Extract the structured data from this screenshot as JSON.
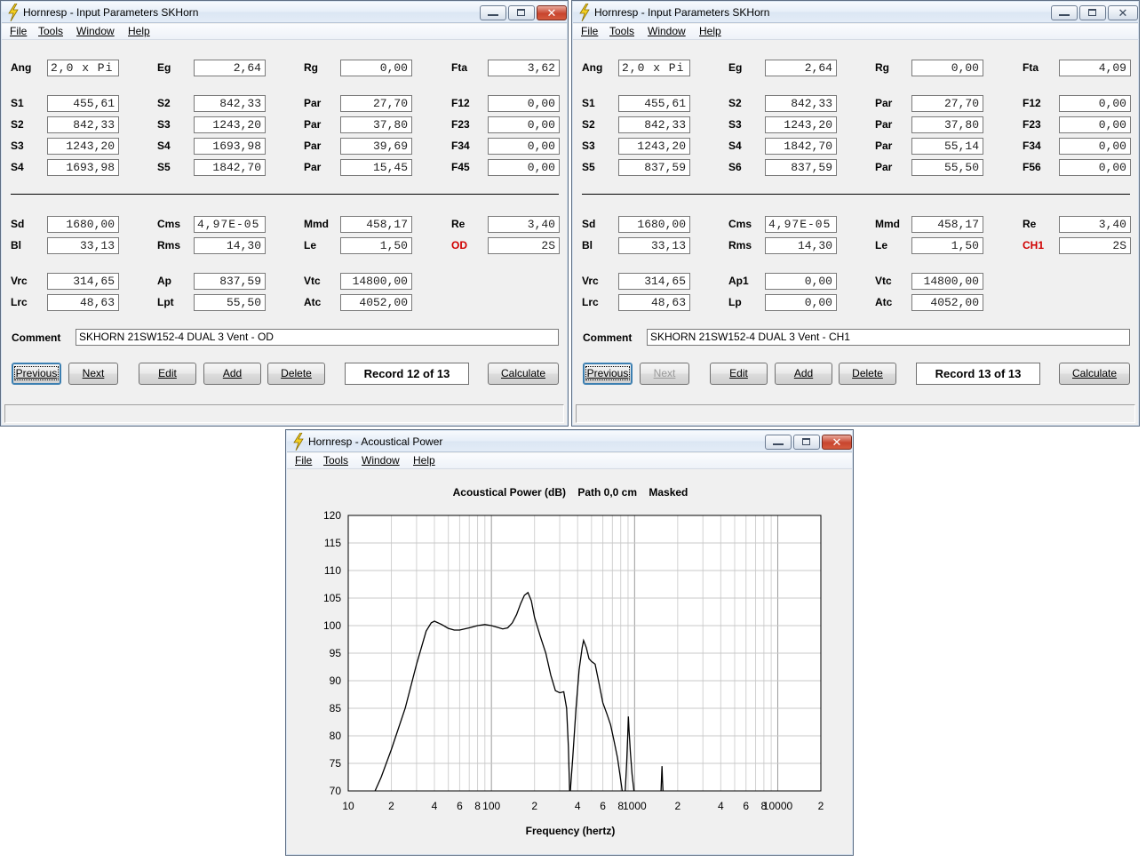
{
  "colors": {
    "accent_red": "#d00000",
    "window_bg": "#f0f0f0",
    "chart_line": "#000000"
  },
  "menu": {
    "file": "File",
    "tools": "Tools",
    "window": "Window",
    "help": "Help"
  },
  "left": {
    "title": "Hornresp - Input Parameters   SKHorn",
    "labels": {
      "ang": "Ang",
      "eg": "Eg",
      "rg": "Rg",
      "fta": "Fta",
      "r1a": "S1",
      "r1b": "S2",
      "r1c": "Par",
      "r1d": "F12",
      "r2a": "S2",
      "r2b": "S3",
      "r2c": "Par",
      "r2d": "F23",
      "r3a": "S3",
      "r3b": "S4",
      "r3c": "Par",
      "r3d": "F34",
      "r4a": "S4",
      "r4b": "S5",
      "r4c": "Par",
      "r4d": "F45",
      "sd": "Sd",
      "cms": "Cms",
      "mmd": "Mmd",
      "re": "Re",
      "bl": "Bl",
      "rms": "Rms",
      "le": "Le",
      "od": "OD",
      "vrc": "Vrc",
      "ap": "Ap",
      "vtc": "Vtc",
      "lrc": "Lrc",
      "lpt": "Lpt",
      "atc": "Atc",
      "comment": "Comment"
    },
    "values": {
      "ang": "2,0 x Pi",
      "eg": "2,64",
      "rg": "0,00",
      "fta": "3,62",
      "r1a": "455,61",
      "r1b": "842,33",
      "r1c": "27,70",
      "r1d": "0,00",
      "r2a": "842,33",
      "r2b": "1243,20",
      "r2c": "37,80",
      "r2d": "0,00",
      "r3a": "1243,20",
      "r3b": "1693,98",
      "r3c": "39,69",
      "r3d": "0,00",
      "r4a": "1693,98",
      "r4b": "1842,70",
      "r4c": "15,45",
      "r4d": "0,00",
      "sd": "1680,00",
      "cms": "4,97E-05",
      "mmd": "458,17",
      "re": "3,40",
      "bl": "33,13",
      "rms": "14,30",
      "le": "1,50",
      "od": "2S",
      "vrc": "314,65",
      "ap": "837,59",
      "vtc": "14800,00",
      "lrc": "48,63",
      "lpt": "55,50",
      "atc": "4052,00",
      "comment": "SKHORN 21SW152-4 DUAL 3 Vent - OD"
    },
    "buttons": {
      "previous": "Previous",
      "next": "Next",
      "edit": "Edit",
      "add": "Add",
      "delete": "Delete",
      "calculate": "Calculate"
    },
    "record": "Record 12 of 13"
  },
  "right": {
    "title": "Hornresp - Input Parameters   SKHorn",
    "labels": {
      "ang": "Ang",
      "eg": "Eg",
      "rg": "Rg",
      "fta": "Fta",
      "r1a": "S1",
      "r1b": "S2",
      "r1c": "Par",
      "r1d": "F12",
      "r2a": "S2",
      "r2b": "S3",
      "r2c": "Par",
      "r2d": "F23",
      "r3a": "S3",
      "r3b": "S4",
      "r3c": "Par",
      "r3d": "F34",
      "r4a": "S5",
      "r4b": "S6",
      "r4c": "Par",
      "r4d": "F56",
      "sd": "Sd",
      "cms": "Cms",
      "mmd": "Mmd",
      "re": "Re",
      "bl": "Bl",
      "rms": "Rms",
      "le": "Le",
      "od": "CH1",
      "vrc": "Vrc",
      "ap": "Ap1",
      "vtc": "Vtc",
      "lrc": "Lrc",
      "lpt": "Lp",
      "atc": "Atc",
      "comment": "Comment"
    },
    "values": {
      "ang": "2,0 x Pi",
      "eg": "2,64",
      "rg": "0,00",
      "fta": "4,09",
      "r1a": "455,61",
      "r1b": "842,33",
      "r1c": "27,70",
      "r1d": "0,00",
      "r2a": "842,33",
      "r2b": "1243,20",
      "r2c": "37,80",
      "r2d": "0,00",
      "r3a": "1243,20",
      "r3b": "1842,70",
      "r3c": "55,14",
      "r3d": "0,00",
      "r4a": "837,59",
      "r4b": "837,59",
      "r4c": "55,50",
      "r4d": "0,00",
      "sd": "1680,00",
      "cms": "4,97E-05",
      "mmd": "458,17",
      "re": "3,40",
      "bl": "33,13",
      "rms": "14,30",
      "le": "1,50",
      "od": "2S",
      "vrc": "314,65",
      "ap": "0,00",
      "vtc": "14800,00",
      "lrc": "48,63",
      "lpt": "0,00",
      "atc": "4052,00",
      "comment": "SKHORN 21SW152-4 DUAL 3 Vent - CH1"
    },
    "buttons": {
      "previous": "Previous",
      "next": "Next",
      "edit": "Edit",
      "add": "Add",
      "delete": "Delete",
      "calculate": "Calculate"
    },
    "record": "Record 13 of 13"
  },
  "power": {
    "title": "Hornresp - Acoustical Power"
  },
  "chart_data": {
    "type": "line",
    "title": "Acoustical Power (dB)    Path 0,0 cm    Masked",
    "xlabel": "Frequency (hertz)",
    "ylabel": "",
    "xscale": "log",
    "xlim": [
      10,
      20000
    ],
    "ylim": [
      70,
      120
    ],
    "grid": true,
    "y_ticks": [
      70,
      75,
      80,
      85,
      90,
      95,
      100,
      105,
      110,
      115,
      120
    ],
    "x_tick_labels": [
      {
        "v": 10,
        "t": "10"
      },
      {
        "v": 20,
        "t": "2"
      },
      {
        "v": 40,
        "t": "4"
      },
      {
        "v": 60,
        "t": "6"
      },
      {
        "v": 80,
        "t": "8"
      },
      {
        "v": 100,
        "t": "100"
      },
      {
        "v": 200,
        "t": "2"
      },
      {
        "v": 400,
        "t": "4"
      },
      {
        "v": 600,
        "t": "6"
      },
      {
        "v": 800,
        "t": "8"
      },
      {
        "v": 1000,
        "t": "1000"
      },
      {
        "v": 2000,
        "t": "2"
      },
      {
        "v": 4000,
        "t": "4"
      },
      {
        "v": 6000,
        "t": "6"
      },
      {
        "v": 8000,
        "t": "8"
      },
      {
        "v": 10000,
        "t": "10000"
      },
      {
        "v": 20000,
        "t": "2"
      }
    ],
    "series": [
      {
        "segments": [
          [
            [
              15.4,
              70
            ],
            [
              17,
              72.5
            ],
            [
              20,
              77.5
            ],
            [
              25,
              85
            ],
            [
              30,
              93
            ],
            [
              35,
              99
            ],
            [
              38,
              100.5
            ],
            [
              40,
              100.8
            ],
            [
              45,
              100.2
            ],
            [
              50,
              99.5
            ],
            [
              55,
              99.2
            ],
            [
              60,
              99.2
            ],
            [
              70,
              99.6
            ],
            [
              80,
              100
            ],
            [
              90,
              100.2
            ],
            [
              100,
              100
            ],
            [
              110,
              99.7
            ],
            [
              120,
              99.4
            ],
            [
              130,
              99.6
            ],
            [
              140,
              100.5
            ],
            [
              150,
              102
            ],
            [
              160,
              104
            ],
            [
              170,
              105.5
            ],
            [
              180,
              106
            ],
            [
              190,
              104.5
            ],
            [
              200,
              101.5
            ],
            [
              220,
              98
            ],
            [
              240,
              95
            ],
            [
              260,
              91
            ],
            [
              280,
              88.2
            ],
            [
              300,
              87.8
            ],
            [
              320,
              88
            ],
            [
              335,
              85
            ],
            [
              345,
              78
            ],
            [
              352,
              70
            ]
          ],
          [
            [
              356,
              70
            ],
            [
              370,
              76
            ],
            [
              390,
              85
            ],
            [
              410,
              92
            ],
            [
              430,
              96
            ],
            [
              440,
              97.3
            ],
            [
              460,
              96
            ],
            [
              480,
              94
            ],
            [
              500,
              93.5
            ],
            [
              530,
              93
            ],
            [
              560,
              90
            ],
            [
              600,
              86
            ],
            [
              640,
              84
            ],
            [
              680,
              82
            ],
            [
              720,
              79
            ],
            [
              760,
              76
            ],
            [
              790,
              73
            ],
            [
              820,
              70
            ]
          ],
          [
            [
              860,
              70
            ],
            [
              880,
              75
            ],
            [
              895,
              80
            ],
            [
              905,
              83.5
            ],
            [
              915,
              81
            ],
            [
              935,
              77
            ],
            [
              960,
              73
            ],
            [
              990,
              70
            ]
          ],
          [
            [
              1530,
              70
            ],
            [
              1545,
              73
            ],
            [
              1555,
              74.5
            ],
            [
              1565,
              72
            ],
            [
              1580,
              70
            ]
          ]
        ]
      }
    ]
  }
}
